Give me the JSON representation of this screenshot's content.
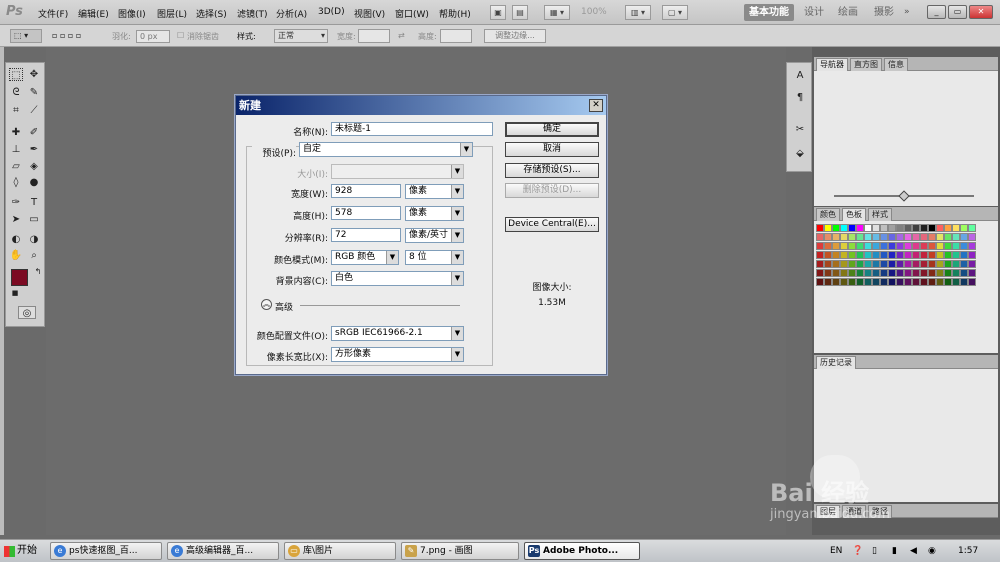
{
  "app": {
    "logo": "Ps"
  },
  "menus": [
    "文件(F)",
    "编辑(E)",
    "图像(I)",
    "图层(L)",
    "选择(S)",
    "滤镜(T)",
    "分析(A)",
    "3D(D)",
    "视图(V)",
    "窗口(W)",
    "帮助(H)"
  ],
  "menubar": {
    "zoom": "100%",
    "workspaces": [
      "基本功能",
      "设计",
      "绘画",
      "摄影"
    ]
  },
  "options": {
    "feather_label": "羽化:",
    "feather_value": "0 px",
    "antialias_label": "消除锯齿",
    "style_label": "样式:",
    "style_value": "正常",
    "width_label": "宽度:",
    "height_label": "高度:",
    "refine_button": "调整边缘..."
  },
  "panels": {
    "top_tabs": [
      "导航器",
      "直方图",
      "信息"
    ],
    "color_tabs": [
      "颜色",
      "色板",
      "样式"
    ],
    "history_tab": "历史记录",
    "bottom_tabs": [
      "图层",
      "通道",
      "路径"
    ]
  },
  "dialog": {
    "title": "新建",
    "name_label": "名称(N):",
    "name_value": "未标题-1",
    "preset_label": "预设(P):",
    "preset_value": "自定",
    "size_label": "大小(I):",
    "width_label": "宽度(W):",
    "width_value": "928",
    "width_unit": "像素",
    "height_label": "高度(H):",
    "height_value": "578",
    "height_unit": "像素",
    "resolution_label": "分辨率(R):",
    "resolution_value": "72",
    "resolution_unit": "像素/英寸",
    "colormode_label": "颜色模式(M):",
    "colormode_value": "RGB 颜色",
    "bitdepth_value": "8 位",
    "background_label": "背景内容(C):",
    "background_value": "白色",
    "advanced_label": "高级",
    "profile_label": "颜色配置文件(O):",
    "profile_value": "sRGB IEC61966-2.1",
    "aspect_label": "像素长宽比(X):",
    "aspect_value": "方形像素",
    "ok_button": "确定",
    "cancel_button": "取消",
    "save_preset_button": "存储预设(S)...",
    "delete_preset_button": "删除预设(D)...",
    "device_central_button": "Device Central(E)...",
    "image_size_label": "图像大小:",
    "image_size_value": "1.53M"
  },
  "taskbar": {
    "start": "开始",
    "tasks": [
      "ps快速抠图_百...",
      "高级编辑器_百...",
      "库\\图片",
      "7.png - 画图",
      "Adobe Photo..."
    ],
    "lang": "EN",
    "time": "1:57"
  },
  "watermark": {
    "brand": "Bai 经验",
    "url": "jingyan.baidu.com"
  }
}
